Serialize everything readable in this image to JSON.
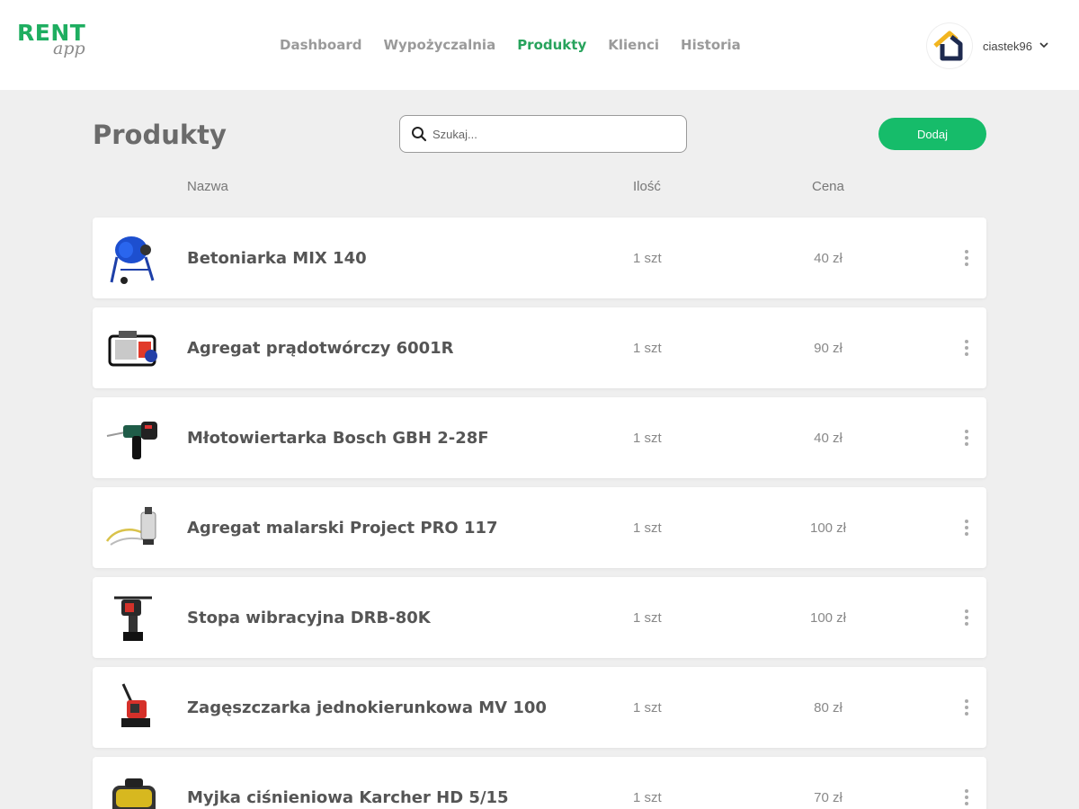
{
  "brand": {
    "name": "RENT",
    "sub": "app"
  },
  "nav": [
    {
      "label": "Dashboard",
      "active": false
    },
    {
      "label": "Wypożyczalnia",
      "active": false
    },
    {
      "label": "Produkty",
      "active": true
    },
    {
      "label": "Klienci",
      "active": false
    },
    {
      "label": "Historia",
      "active": false
    }
  ],
  "user": {
    "name": "ciastek96"
  },
  "page": {
    "title": "Produkty"
  },
  "search": {
    "placeholder": "Szukaj..."
  },
  "actions": {
    "add_label": "Dodaj"
  },
  "columns": {
    "name": "Nazwa",
    "quantity": "Ilość",
    "price": "Cena"
  },
  "products": [
    {
      "name": "Betoniarka MIX 140",
      "quantity": "1 szt",
      "price": "40 zł",
      "icon": "concrete-mixer-icon"
    },
    {
      "name": "Agregat prądotwórczy 6001R",
      "quantity": "1 szt",
      "price": "90 zł",
      "icon": "generator-icon"
    },
    {
      "name": "Młotowiertarka Bosch GBH 2-28F",
      "quantity": "1 szt",
      "price": "40 zł",
      "icon": "hammer-drill-icon"
    },
    {
      "name": "Agregat malarski Project PRO 117",
      "quantity": "1 szt",
      "price": "100 zł",
      "icon": "paint-sprayer-icon"
    },
    {
      "name": "Stopa wibracyjna DRB-80K",
      "quantity": "1 szt",
      "price": "100 zł",
      "icon": "tamping-rammer-icon"
    },
    {
      "name": "Zagęszczarka jednokierunkowa MV 100",
      "quantity": "1 szt",
      "price": "80 zł",
      "icon": "plate-compactor-icon"
    },
    {
      "name": "Myjka ciśnieniowa Karcher HD 5/15",
      "quantity": "1 szt",
      "price": "70 zł",
      "icon": "pressure-washer-icon"
    }
  ],
  "colors": {
    "accent": "#27a35c",
    "button": "#16bc6a",
    "background": "#efefef"
  }
}
